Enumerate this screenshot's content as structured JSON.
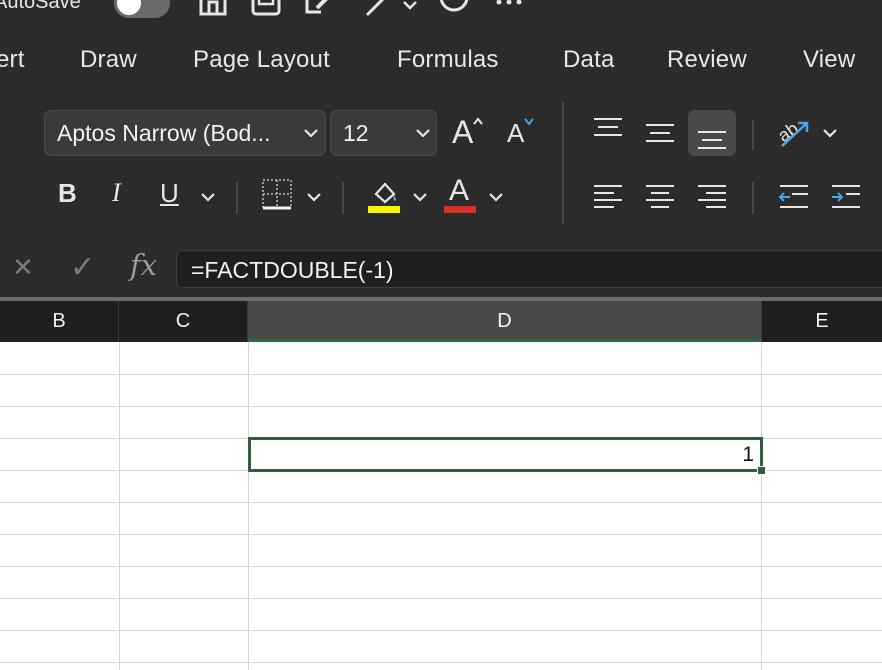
{
  "titlebar": {
    "autosave_label": "AutoSave",
    "autosave_on": false,
    "icons": [
      "home-icon",
      "save-icon",
      "edit-icon",
      "pen-icon",
      "chevron-down-icon",
      "circle-icon",
      "more-icon"
    ]
  },
  "tabs": [
    {
      "id": "insert",
      "label": "ert"
    },
    {
      "id": "draw",
      "label": "Draw"
    },
    {
      "id": "page-layout",
      "label": "Page Layout"
    },
    {
      "id": "formulas",
      "label": "Formulas"
    },
    {
      "id": "data",
      "label": "Data"
    },
    {
      "id": "review",
      "label": "Review"
    },
    {
      "id": "view",
      "label": "View"
    }
  ],
  "ribbon": {
    "font_name": "Aptos Narrow (Bod...",
    "font_size": "12",
    "grow_font_label": "A",
    "shrink_font_label": "A",
    "bold_label": "B",
    "italic_label": "I",
    "underline_label": "U",
    "font_color_label": "A",
    "fill_color": "#f5f500",
    "font_color": "#d93025",
    "accent": "#2e5e3c"
  },
  "formula_bar": {
    "cancel_label": "✕",
    "confirm_label": "✓",
    "fx_label": "fx",
    "formula": "=FACTDOUBLE(-1)"
  },
  "grid": {
    "columns": [
      "B",
      "C",
      "D",
      "E"
    ],
    "selected_column": "D",
    "active_cell_value": "1"
  }
}
